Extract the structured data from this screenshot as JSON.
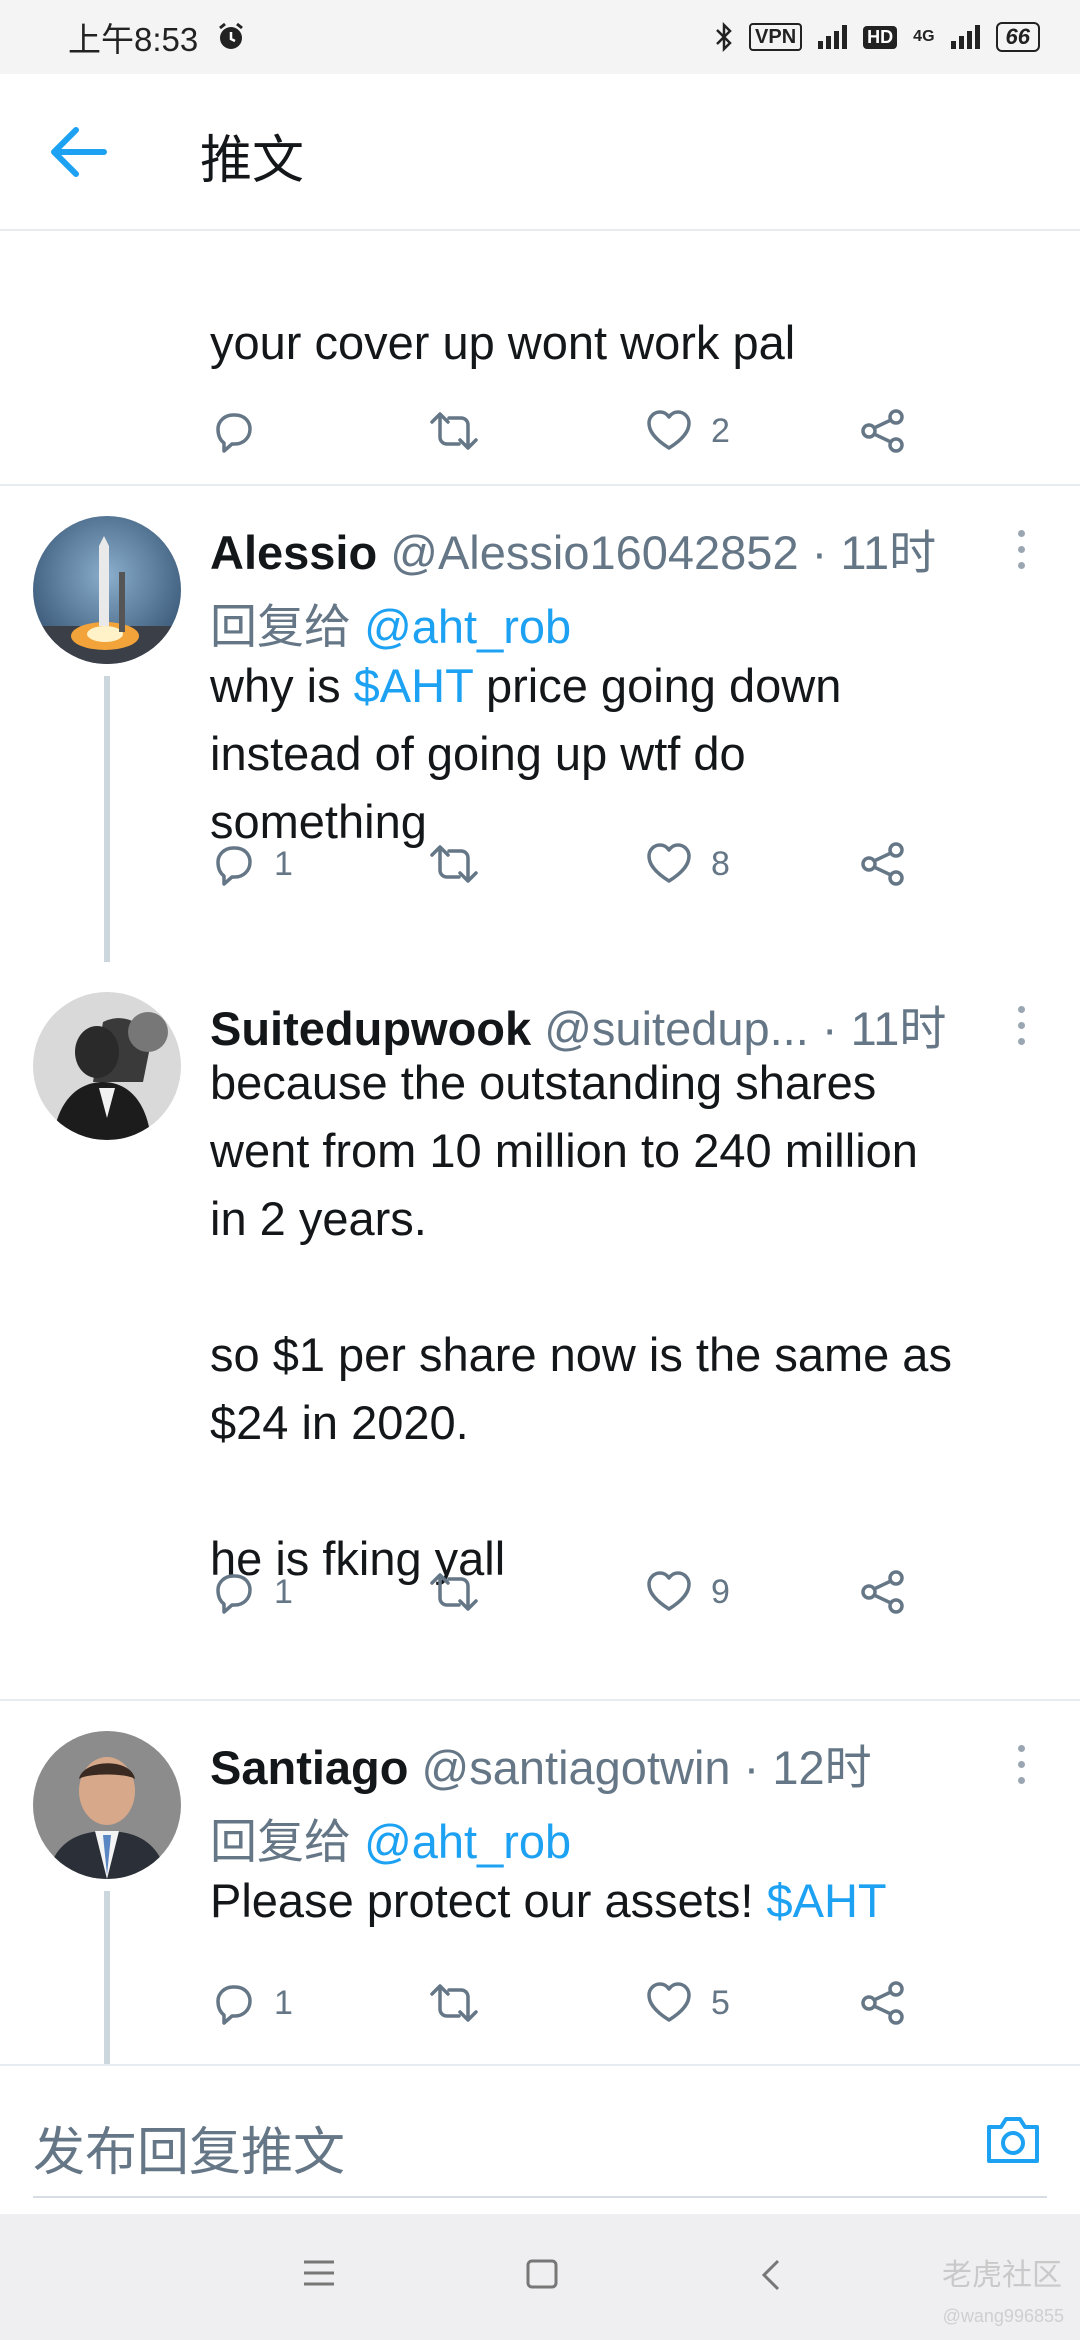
{
  "status_bar": {
    "time": "上午8:53",
    "vpn": "VPN",
    "hd": "HD",
    "network": "4G",
    "battery": "66"
  },
  "header": {
    "title": "推文"
  },
  "tweets": [
    {
      "body": "your cover up wont work pal",
      "reply_count": "",
      "like_count": "2"
    },
    {
      "name": "Alessio",
      "handle": "@Alessio16042852",
      "dot": "·",
      "time": "11时",
      "reply_prefix": "回复给",
      "reply_to": "@aht_rob",
      "body_before": "why is ",
      "cashtag": "$AHT",
      "body_after": " price going down\ninstead of going up wtf do\nsomething",
      "reply_count": "1",
      "like_count": "8"
    },
    {
      "name": "Suitedupwook",
      "handle": "@suitedup...",
      "dot": "·",
      "time": "11时",
      "body": "because the outstanding shares\nwent from 10 million to 240 million\nin 2 years.\n\nso $1 per share now is the same as\n$24 in 2020.\n\nhe is fking yall",
      "reply_count": "1",
      "like_count": "9"
    },
    {
      "name": "Santiago",
      "handle": "@santiagotwin",
      "dot": "·",
      "time": "12时",
      "reply_prefix": "回复给",
      "reply_to": "@aht_rob",
      "body_before": "Please protect our assets! ",
      "cashtag": "$AHT",
      "reply_count": "1",
      "like_count": "5"
    }
  ],
  "reply_bar": {
    "placeholder": "发布回复推文"
  },
  "watermark": {
    "text": "老虎社区",
    "user": "@wang996855"
  },
  "icons": {
    "back": "back-arrow-icon",
    "reply": "reply-icon",
    "retweet": "retweet-icon",
    "like": "heart-icon",
    "share": "share-icon",
    "more": "more-vertical-icon",
    "camera": "camera-icon"
  },
  "colors": {
    "accent": "#1da1f2",
    "muted": "#657786",
    "text": "#14171a"
  }
}
